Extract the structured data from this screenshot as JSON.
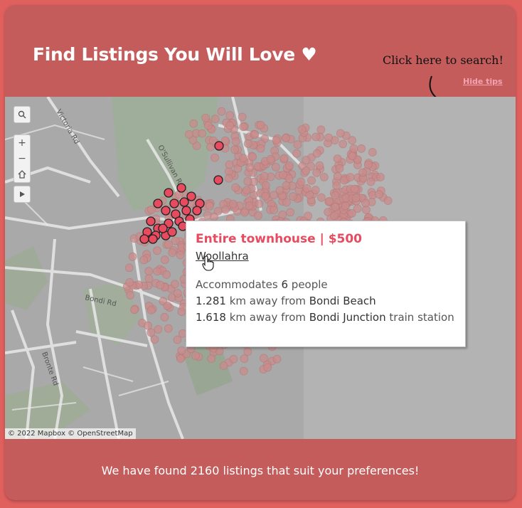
{
  "header": {
    "title": "Find Listings You Will Love ♥",
    "tip_text": "Click here to search!",
    "hide_tips_label": "Hide tips"
  },
  "map": {
    "attribution": "© 2022 Mapbox © OpenStreetMap",
    "street_labels": [
      "Victoria Rd",
      "O'Sullivan Rd",
      "Bondi Rd",
      "Bronte Rd"
    ],
    "controls": [
      "search-icon",
      "zoom-in-icon",
      "zoom-out-icon",
      "home-icon",
      "play-icon"
    ],
    "marker_color": "#e84a5f"
  },
  "tooltip": {
    "heading": "Entire townhouse | $500",
    "suburb": "Woollahra",
    "accommodates_prefix": "Accommodates ",
    "accommodates_value": "6",
    "accommodates_suffix": " people",
    "beach_distance": "1.281",
    "beach_mid": " km away from ",
    "beach_name": "Bondi Beach",
    "station_distance": "1.618",
    "station_mid": " km away from ",
    "station_name": "Bondi Junction",
    "station_suffix": " train station"
  },
  "footer": {
    "summary": "We have found 2160 listings that suit your preferences!"
  },
  "colors": {
    "page_bg": "#e0605e",
    "card_bg": "#c45c5c",
    "accent": "#e84a5f"
  }
}
